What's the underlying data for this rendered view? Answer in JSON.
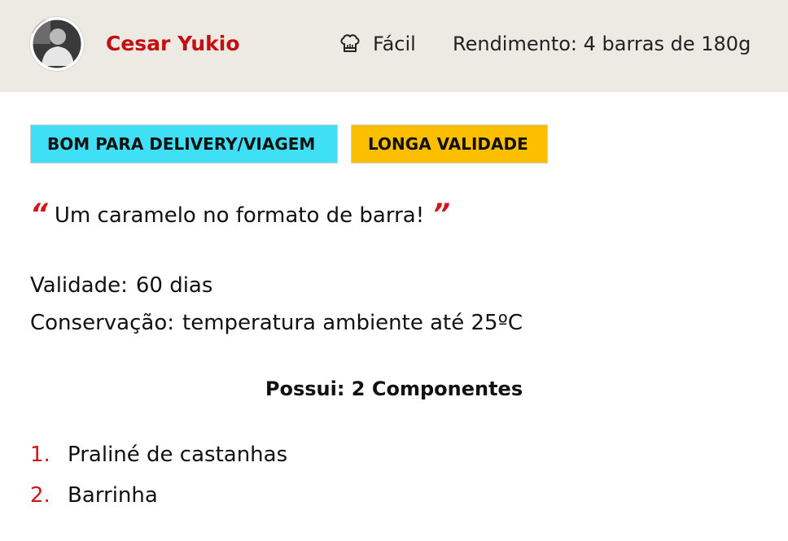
{
  "header": {
    "author": "Cesar Yukio",
    "difficulty": "Fácil",
    "difficulty_icon": "chef-hat-icon",
    "yield": "Rendimento: 4 barras de 180g"
  },
  "tags": [
    {
      "label": "BOM PARA DELIVERY/VIAGEM",
      "color": "#3fe0f5"
    },
    {
      "label": "LONGA VALIDADE",
      "color": "#fbbf00"
    }
  ],
  "quote": {
    "open_mark": "“",
    "text": "Um caramelo no formato de barra!",
    "close_mark": "”"
  },
  "info": {
    "validade_label": "Validade:",
    "validade_value": "60 dias",
    "conservacao_label": "Conservação:",
    "conservacao_value": "temperatura ambiente até 25ºC"
  },
  "components": {
    "title": "Possui: 2 Componentes",
    "items": [
      {
        "number": "1.",
        "name": "Praliné de castanhas"
      },
      {
        "number": "2.",
        "name": "Barrinha"
      }
    ]
  },
  "colors": {
    "accent": "#c40f12",
    "header_bg": "#ede9e3"
  }
}
